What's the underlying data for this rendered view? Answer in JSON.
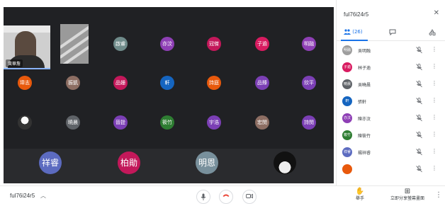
{
  "meeting": {
    "code": "ful76i24r5"
  },
  "stage": {
    "self_name": "黃華詹",
    "row1": [
      {
        "label": "啟睿",
        "color": "#6f8b8a"
      },
      {
        "label": "亦汶",
        "color": "#8e3fb5"
      },
      {
        "label": "冠傑",
        "color": "#c3185a"
      },
      {
        "label": "子逾",
        "color": "#d81b60"
      },
      {
        "label": "明融",
        "color": "#8e3fb5"
      }
    ],
    "row2": [
      {
        "label": "瑋志",
        "color": "#e8590c"
      },
      {
        "label": "振凱",
        "color": "#8d6e63"
      },
      {
        "label": "品姗",
        "color": "#c3185a"
      },
      {
        "label": "軒",
        "color": "#1565c0"
      },
      {
        "label": "詩庭",
        "color": "#e8590c"
      },
      {
        "label": "品臻",
        "color": "#7b3fb5"
      },
      {
        "label": "欣平",
        "color": "#7b3fb5"
      }
    ],
    "row3": [
      {
        "label": "",
        "color": "#333"
      },
      {
        "label": "曉晨",
        "color": "#5f6368"
      },
      {
        "label": "晉銓",
        "color": "#7b3fb5"
      },
      {
        "label": "筱竹",
        "color": "#2e7d32"
      },
      {
        "label": "宇浩",
        "color": "#7b3fb5"
      },
      {
        "label": "宏閔",
        "color": "#8d6e63"
      },
      {
        "label": "詩閔",
        "color": "#7b3fb5"
      }
    ],
    "row4": [
      {
        "label": "祥睿",
        "color": "#5c6bc0"
      },
      {
        "label": "柏勛",
        "color": "#c3185a"
      },
      {
        "label": "明恩",
        "color": "#78909c"
      },
      {
        "label": "",
        "color": "#111"
      }
    ]
  },
  "panel": {
    "title": "ful76i24r5",
    "close_icon": "close-icon",
    "tab_people_count": "(26)",
    "participants": [
      {
        "initials": "明融",
        "name": "吳明融",
        "color": "#9e9e9e"
      },
      {
        "initials": "子逾",
        "name": "林子逾",
        "color": "#d81b60"
      },
      {
        "initials": "曉晨",
        "name": "吳曉晨",
        "color": "#5f6368"
      },
      {
        "initials": "軒",
        "name": "張軒",
        "color": "#1565c0"
      },
      {
        "initials": "亦汶",
        "name": "陳亦汶",
        "color": "#8e3fb5"
      },
      {
        "initials": "筱竹",
        "name": "陳筱竹",
        "color": "#2e7d32"
      },
      {
        "initials": "祥睿",
        "name": "楊祥睿",
        "color": "#5c6bc0"
      },
      {
        "initials": "",
        "name": "",
        "color": "#e8590c"
      }
    ]
  },
  "bottombar": {
    "code": "ful76i24r5",
    "raise_hand_label": "舉手",
    "present_label": "立即分享螢幕畫面"
  },
  "colors": {
    "accent": "#1a73e8",
    "hangup": "#ea4335",
    "stage_bg": "#202124"
  }
}
